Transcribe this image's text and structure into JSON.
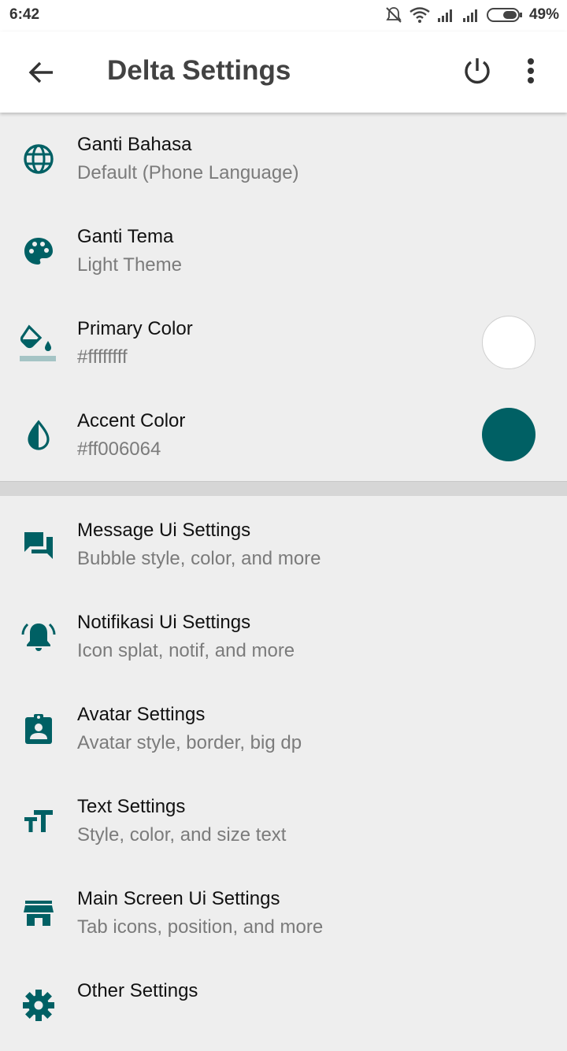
{
  "status_bar": {
    "time": "6:42",
    "battery": "49%",
    "icons": [
      "mute-icon",
      "wifi-icon",
      "signal-icon",
      "signal-icon",
      "battery-icon"
    ]
  },
  "app_bar": {
    "title": "Delta Settings",
    "icons": [
      "back-arrow-icon",
      "power-icon",
      "more-vert-icon"
    ]
  },
  "colors": {
    "accent": "#006064",
    "primary": "#ffffff",
    "background": "#eeeeee"
  },
  "theme_settings": [
    {
      "icon": "globe-icon",
      "label": "Ganti Bahasa",
      "value": "Default (Phone Language)"
    },
    {
      "icon": "palette-icon",
      "label": "Ganti Tema",
      "value": "Light Theme"
    },
    {
      "icon": "paint-bucket-icon",
      "label": "Primary Color",
      "value": "#ffffffff",
      "swatch": "#ffffff"
    },
    {
      "icon": "drop-half-icon",
      "label": "Accent Color",
      "value": "#ff006064",
      "swatch": "#006064"
    }
  ],
  "ui_settings": [
    {
      "icon": "chat-icon",
      "label": "Message Ui Settings",
      "value": "Bubble style, color, and more"
    },
    {
      "icon": "bell-ring-icon",
      "label": "Notifikasi Ui Settings",
      "value": "Icon splat, notif, and more"
    },
    {
      "icon": "contact-card-icon",
      "label": "Avatar Settings",
      "value": "Avatar style, border, big dp"
    },
    {
      "icon": "text-size-icon",
      "label": "Text Settings",
      "value": "Style, color, and size text"
    },
    {
      "icon": "store-icon",
      "label": "Main Screen Ui Settings",
      "value": "Tab icons, position, and more"
    },
    {
      "icon": "gear-icon",
      "label": "Other Settings",
      "value": ""
    }
  ]
}
